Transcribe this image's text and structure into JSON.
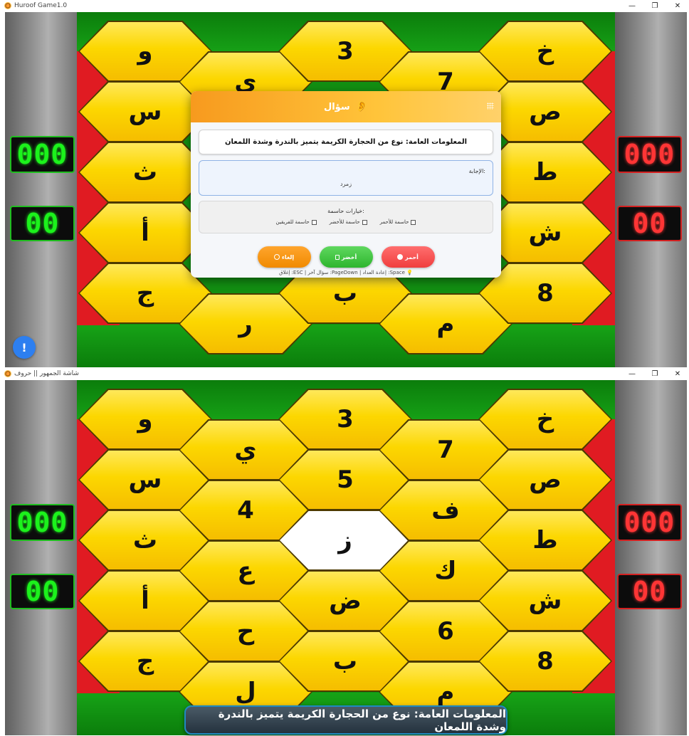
{
  "window1": {
    "title": "Huroof Game1.0",
    "controls": {
      "minimize": "—",
      "maximize": "❐",
      "close": "✕"
    }
  },
  "window2": {
    "title": "شاشة الجمهور || حروف",
    "controls": {
      "minimize": "—",
      "maximize": "❐",
      "close": "✕"
    }
  },
  "board": {
    "cells": [
      "و",
      "ي",
      "ث",
      "ض",
      "ف",
      "ط",
      "4",
      "3",
      "خ",
      "س",
      "7",
      "ع",
      "ب",
      "م",
      "ك",
      "ص",
      "ج",
      "5",
      "ر",
      "ش",
      "6",
      "8",
      "ز",
      "ح",
      "أ",
      "ل"
    ],
    "highlighted_cell": "ز"
  },
  "scores": {
    "green_team": {
      "points": "000",
      "letters": "00"
    },
    "red_team": {
      "points": "000",
      "letters": "00"
    }
  },
  "info_button_label": "!",
  "question_dialog": {
    "title": "سؤال",
    "ear_icon": "👂",
    "question_text": "المعلومات العامة: نوع من الحجارة الكريمة يتميز بالندرة وشدة اللمعان",
    "answer_label": "الإجابة:",
    "answer_value": "زمرد",
    "options_label": "خيارات حاسمة:",
    "options": [
      "حاسمة للأحمر",
      "حاسمة للأخضر",
      "حاسمة للفريقين"
    ],
    "buttons": {
      "red": "أحمر",
      "green": "أخضر",
      "cancel": "إلغاء"
    },
    "hints": "💡 Space: إعادة العداد  |  PageDown: سؤال آخر  |  ESC: إغلاق"
  },
  "audience_banner": "المعلومات العامة: نوع من الحجارة الكريمة يتميز بالندرة وشدة اللمعان",
  "colors": {
    "green_team": "#1cf21c",
    "red_team": "#ff3535",
    "accent": "#f79a1e",
    "hex_fill": "#fcd700"
  }
}
